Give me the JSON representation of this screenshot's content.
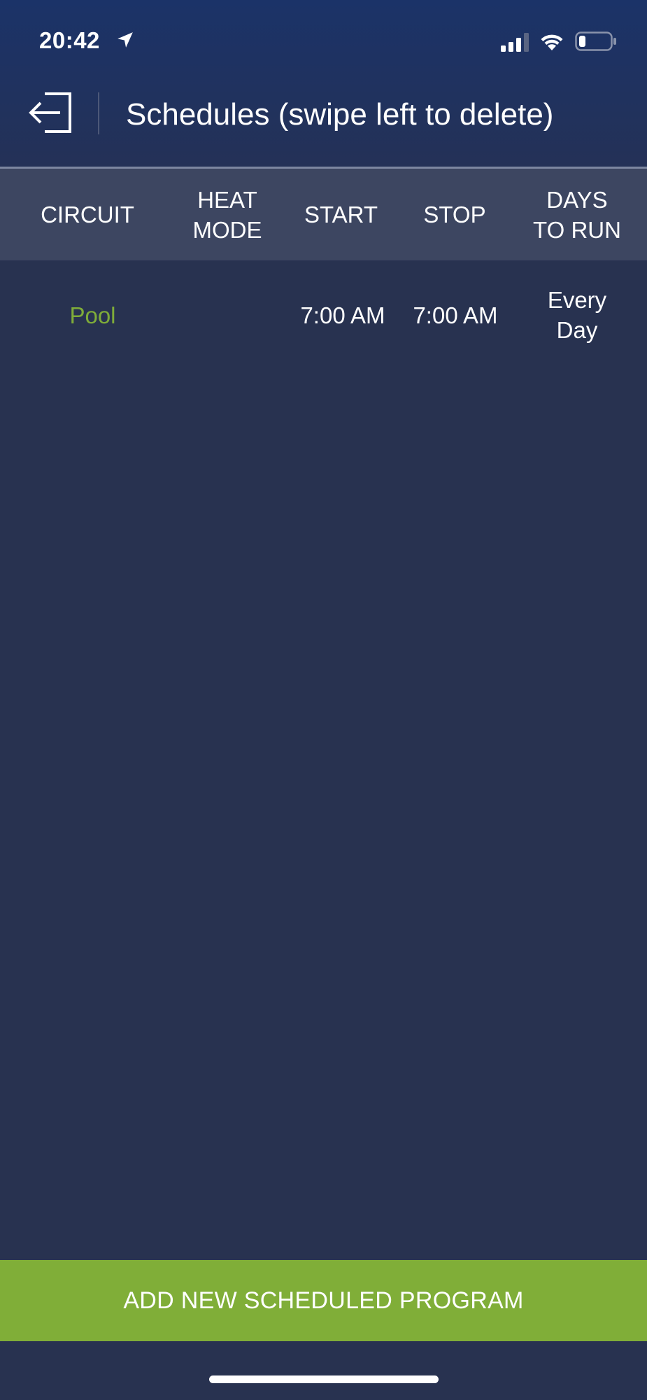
{
  "status_bar": {
    "time": "20:42",
    "icons": [
      "location-arrow-icon",
      "cellular-signal-icon",
      "wifi-icon",
      "battery-icon"
    ]
  },
  "nav": {
    "back_icon": "exit-arrow-icon",
    "title": "Schedules (swipe left to delete)"
  },
  "table": {
    "headers": {
      "circuit": "CIRCUIT",
      "heat_mode_line1": "HEAT",
      "heat_mode_line2": "MODE",
      "start": "START",
      "stop": "STOP",
      "days_line1": "DAYS",
      "days_line2": "TO RUN"
    },
    "rows": [
      {
        "circuit": "Pool",
        "heat_mode": "",
        "start": "7:00 AM",
        "stop": "7:00 AM",
        "days": "Every Day"
      }
    ]
  },
  "actions": {
    "add_label": "ADD NEW SCHEDULED PROGRAM"
  },
  "colors": {
    "background": "#283250",
    "header_gradient_top": "#1b3368",
    "table_header": "#3d4661",
    "accent_green": "#80ae38",
    "circuit_text": "#7fac39"
  }
}
